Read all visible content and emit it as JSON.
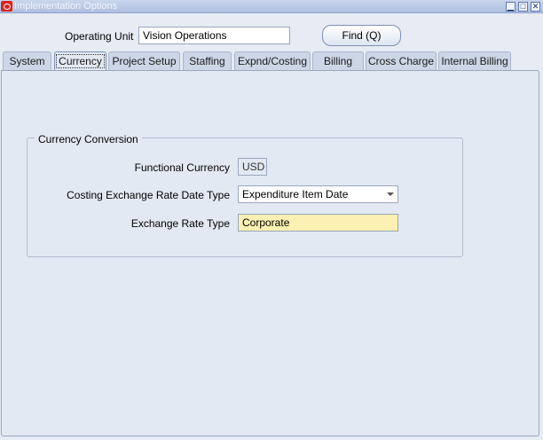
{
  "window": {
    "title": "Implementation Options",
    "minimize": "▁",
    "restore": "□",
    "close": "✕"
  },
  "header": {
    "operating_unit_label": "Operating Unit",
    "operating_unit_value": "Vision Operations",
    "find_button": "Find (Q)"
  },
  "tabs": [
    {
      "label": "System"
    },
    {
      "label": "Currency",
      "active": true
    },
    {
      "label": "Project Setup"
    },
    {
      "label": "Staffing"
    },
    {
      "label": "Expnd/Costing"
    },
    {
      "label": "Billing"
    },
    {
      "label": "Cross Charge"
    },
    {
      "label": "Internal Billing"
    }
  ],
  "currency_conversion": {
    "title": "Currency Conversion",
    "functional_currency_label": "Functional Currency",
    "functional_currency_value": "USD",
    "costing_rate_date_type_label": "Costing Exchange Rate Date Type",
    "costing_rate_date_type_value": "Expenditure Item Date",
    "exchange_rate_type_label": "Exchange Rate Type",
    "exchange_rate_type_value": "Corporate"
  },
  "colors": {
    "required_field": "#fcf0b2",
    "panel": "#e3e9f3",
    "title_bar": "#aebfe0"
  }
}
